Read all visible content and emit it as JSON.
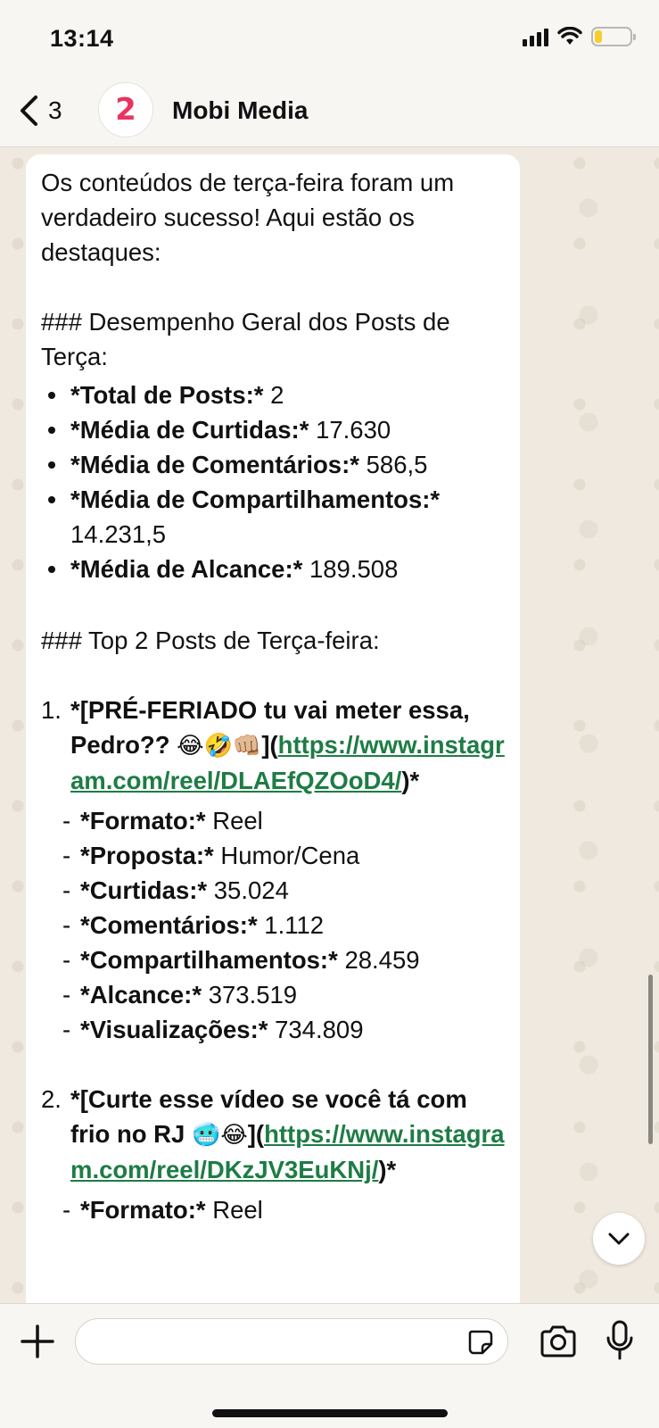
{
  "status_bar": {
    "time": "13:14",
    "battery_level": 0.2,
    "battery_color": "#f4cf2c"
  },
  "header": {
    "back_count": "3",
    "avatar_glyph": "2",
    "contact_name": "Mobi Media"
  },
  "message": {
    "intro": "Os conteúdos de terça-feira foram um verdadeiro sucesso! Aqui estão os destaques:",
    "section1_title": "### Desempenho Geral dos Posts de Terça:",
    "summary": [
      {
        "label": "*Total de Posts:*",
        "value": "2"
      },
      {
        "label": "*Média de Curtidas:*",
        "value": "17.630"
      },
      {
        "label": "*Média de Comentários:*",
        "value": "586,5"
      },
      {
        "label": "*Média de Compartilhamentos:*",
        "value": "14.231,5"
      },
      {
        "label": "*Média de Alcance:*",
        "value": "189.508"
      }
    ],
    "section2_title": "### Top 2 Posts de Terça-feira:",
    "posts": [
      {
        "number": "1.",
        "title_open": "*[PRÉ-FERIADO tu vai meter essa, Pedro?? ",
        "emojis": "😂🤣👊🏼",
        "title_close": "](",
        "url": "https://www.instagram.com/reel/DLAEfQZOoD4/",
        "suffix": ")*",
        "details": [
          {
            "label": "*Formato:*",
            "value": "Reel"
          },
          {
            "label": "*Proposta:*",
            "value": "Humor/Cena"
          },
          {
            "label": "*Curtidas:*",
            "value": "35.024"
          },
          {
            "label": "*Comentários:*",
            "value": "1.112"
          },
          {
            "label": "*Compartilhamentos:*",
            "value": "28.459"
          },
          {
            "label": "*Alcance:*",
            "value": "373.519"
          },
          {
            "label": "*Visualizações:*",
            "value": "734.809"
          }
        ]
      },
      {
        "number": "2.",
        "title_open": "*[Curte esse vídeo se você tá com frio no RJ ",
        "emojis": "🥶😂",
        "title_close": "](",
        "url": "https://www.instagram.com/reel/DKzJV3EuKNj/",
        "suffix": ")*",
        "details": [
          {
            "label": "*Formato:*",
            "value": "Reel"
          }
        ]
      }
    ]
  },
  "composer": {
    "placeholder": ""
  },
  "colors": {
    "link": "#1e7c45",
    "accent_avatar": "#e8345f",
    "wallpaper": "#efe9df"
  },
  "icons": [
    "chevron-left-icon",
    "plus-icon",
    "sticker-icon",
    "camera-icon",
    "microphone-icon",
    "chevron-down-icon",
    "wifi-icon",
    "signal-icon",
    "battery-icon"
  ]
}
